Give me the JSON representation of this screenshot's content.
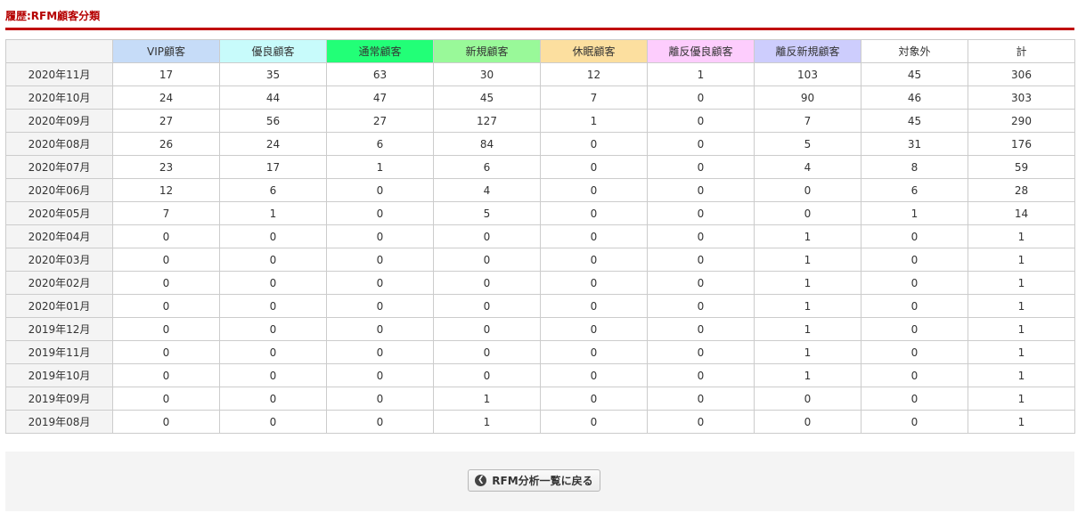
{
  "title": "履歴:RFM顧客分類",
  "columns": [
    {
      "label": "VIP顧客",
      "color": "#c6dcf8"
    },
    {
      "label": "優良顧客",
      "color": "#c8fbfb"
    },
    {
      "label": "通常顧客",
      "color": "#22ff77"
    },
    {
      "label": "新規顧客",
      "color": "#99f999"
    },
    {
      "label": "休眠顧客",
      "color": "#fcdf9f"
    },
    {
      "label": "離反優良顧客",
      "color": "#fdcdfd"
    },
    {
      "label": "離反新規顧客",
      "color": "#cdcdfd"
    },
    {
      "label": "対象外",
      "color": "#ffffff"
    },
    {
      "label": "計",
      "color": "#ffffff"
    }
  ],
  "rows": [
    {
      "month": "2020年11月",
      "values": [
        17,
        35,
        63,
        30,
        12,
        1,
        103,
        45,
        306
      ]
    },
    {
      "month": "2020年10月",
      "values": [
        24,
        44,
        47,
        45,
        7,
        0,
        90,
        46,
        303
      ]
    },
    {
      "month": "2020年09月",
      "values": [
        27,
        56,
        27,
        127,
        1,
        0,
        7,
        45,
        290
      ]
    },
    {
      "month": "2020年08月",
      "values": [
        26,
        24,
        6,
        84,
        0,
        0,
        5,
        31,
        176
      ]
    },
    {
      "month": "2020年07月",
      "values": [
        23,
        17,
        1,
        6,
        0,
        0,
        4,
        8,
        59
      ]
    },
    {
      "month": "2020年06月",
      "values": [
        12,
        6,
        0,
        4,
        0,
        0,
        0,
        6,
        28
      ]
    },
    {
      "month": "2020年05月",
      "values": [
        7,
        1,
        0,
        5,
        0,
        0,
        0,
        1,
        14
      ]
    },
    {
      "month": "2020年04月",
      "values": [
        0,
        0,
        0,
        0,
        0,
        0,
        1,
        0,
        1
      ]
    },
    {
      "month": "2020年03月",
      "values": [
        0,
        0,
        0,
        0,
        0,
        0,
        1,
        0,
        1
      ]
    },
    {
      "month": "2020年02月",
      "values": [
        0,
        0,
        0,
        0,
        0,
        0,
        1,
        0,
        1
      ]
    },
    {
      "month": "2020年01月",
      "values": [
        0,
        0,
        0,
        0,
        0,
        0,
        1,
        0,
        1
      ]
    },
    {
      "month": "2019年12月",
      "values": [
        0,
        0,
        0,
        0,
        0,
        0,
        1,
        0,
        1
      ]
    },
    {
      "month": "2019年11月",
      "values": [
        0,
        0,
        0,
        0,
        0,
        0,
        1,
        0,
        1
      ]
    },
    {
      "month": "2019年10月",
      "values": [
        0,
        0,
        0,
        0,
        0,
        0,
        1,
        0,
        1
      ]
    },
    {
      "month": "2019年09月",
      "values": [
        0,
        0,
        0,
        1,
        0,
        0,
        0,
        0,
        1
      ]
    },
    {
      "month": "2019年08月",
      "values": [
        0,
        0,
        0,
        1,
        0,
        0,
        0,
        0,
        1
      ]
    }
  ],
  "back_button": {
    "label": "RFM分析一覧に戻る",
    "icon": "chevron-left-circle-icon"
  }
}
